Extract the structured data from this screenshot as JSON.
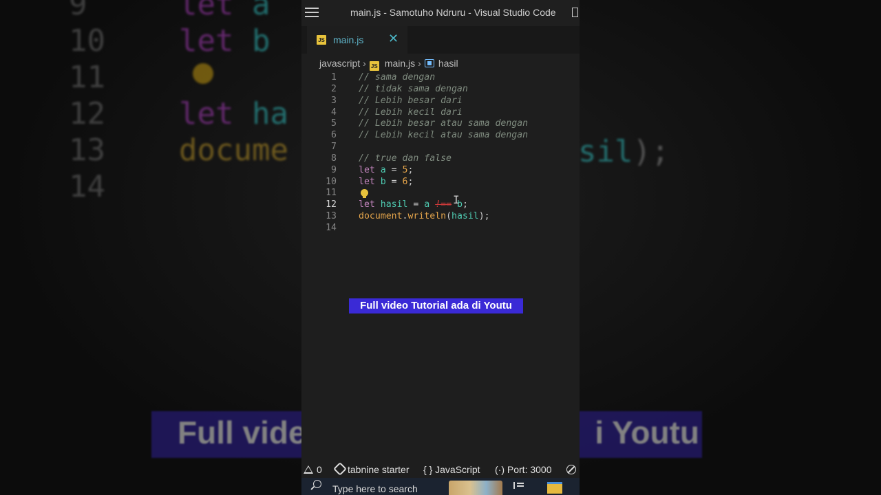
{
  "window": {
    "title": "main.js - Samotuho Ndruru - Visual Studio Code"
  },
  "tab": {
    "label": "main.js"
  },
  "breadcrumb": {
    "folder": "javascript",
    "file": "main.js",
    "symbol": "hasil"
  },
  "editor": {
    "active_line": 12,
    "lines": [
      {
        "n": "1",
        "tokens": [
          {
            "t": "// sama dengan",
            "c": "c"
          }
        ]
      },
      {
        "n": "2",
        "tokens": [
          {
            "t": "// tidak sama dengan",
            "c": "c"
          }
        ]
      },
      {
        "n": "3",
        "tokens": [
          {
            "t": "// Lebih besar dari",
            "c": "c"
          }
        ]
      },
      {
        "n": "4",
        "tokens": [
          {
            "t": "// Lebih kecil dari",
            "c": "c"
          }
        ]
      },
      {
        "n": "5",
        "tokens": [
          {
            "t": "// Lebih besar atau sama dengan",
            "c": "c"
          }
        ]
      },
      {
        "n": "6",
        "tokens": [
          {
            "t": "// Lebih kecil atau sama dengan",
            "c": "c"
          }
        ]
      },
      {
        "n": "7",
        "tokens": []
      },
      {
        "n": "8",
        "tokens": [
          {
            "t": "// true dan false",
            "c": "c"
          }
        ]
      },
      {
        "n": "9",
        "tokens": [
          {
            "t": "let ",
            "c": "k"
          },
          {
            "t": "a",
            "c": "v"
          },
          {
            "t": " = ",
            "c": "o"
          },
          {
            "t": "5",
            "c": "n"
          },
          {
            "t": ";",
            "c": "p"
          }
        ]
      },
      {
        "n": "10",
        "tokens": [
          {
            "t": "let ",
            "c": "k"
          },
          {
            "t": "b",
            "c": "v"
          },
          {
            "t": " = ",
            "c": "o"
          },
          {
            "t": "6",
            "c": "n"
          },
          {
            "t": ";",
            "c": "p"
          }
        ]
      },
      {
        "n": "11",
        "tokens": [],
        "bulb": true
      },
      {
        "n": "12",
        "tokens": [
          {
            "t": "let ",
            "c": "k"
          },
          {
            "t": "hasil",
            "c": "v"
          },
          {
            "t": " = ",
            "c": "o"
          },
          {
            "t": "a",
            "c": "v"
          },
          {
            "t": " ",
            "c": "o"
          },
          {
            "t": "!==",
            "c": "err"
          },
          {
            "t": " ",
            "c": "o"
          },
          {
            "t": "b",
            "c": "v"
          },
          {
            "t": ";",
            "c": "p"
          }
        ],
        "cursor": true
      },
      {
        "n": "13",
        "tokens": [
          {
            "t": "document",
            "c": "f"
          },
          {
            "t": ".",
            "c": "p"
          },
          {
            "t": "writeln",
            "c": "f"
          },
          {
            "t": "(",
            "c": "p"
          },
          {
            "t": "hasil",
            "c": "v"
          },
          {
            "t": ");",
            "c": "p"
          }
        ]
      },
      {
        "n": "14",
        "tokens": []
      }
    ]
  },
  "overlay": {
    "banner_text": "Full video Tutorial ada di Youtu"
  },
  "background": {
    "lines": [
      {
        "n": "9",
        "parts": [
          {
            "t": "let ",
            "c": "bg-kw"
          },
          {
            "t": "a",
            "c": "bg-var"
          }
        ]
      },
      {
        "n": "10",
        "parts": [
          {
            "t": "let ",
            "c": "bg-kw"
          },
          {
            "t": "b",
            "c": "bg-var"
          }
        ]
      },
      {
        "n": "11",
        "parts": []
      },
      {
        "n": "12",
        "parts": [
          {
            "t": "let ",
            "c": "bg-kw"
          },
          {
            "t": "ha",
            "c": "bg-var"
          }
        ]
      },
      {
        "n": "13",
        "parts": [
          {
            "t": "docume",
            "c": "bg-fn"
          }
        ]
      },
      {
        "n": "14",
        "parts": []
      }
    ],
    "right_fragment_var": "sil",
    "right_fragment_tail": ");",
    "banner_left": "Full vide",
    "banner_right": "i Youtu"
  },
  "statusbar": {
    "problems": "0",
    "tabnine": "tabnine starter",
    "language": "JavaScript",
    "port": "Port: 3000"
  },
  "taskbar": {
    "search_placeholder": "Type here to search"
  },
  "colors": {
    "banner_bg": "#3a2ad6",
    "editor_bg": "#1e1e1e",
    "keyword": "#c586c0",
    "variable": "#4ec9b0",
    "comment": "#7f8b7f"
  }
}
